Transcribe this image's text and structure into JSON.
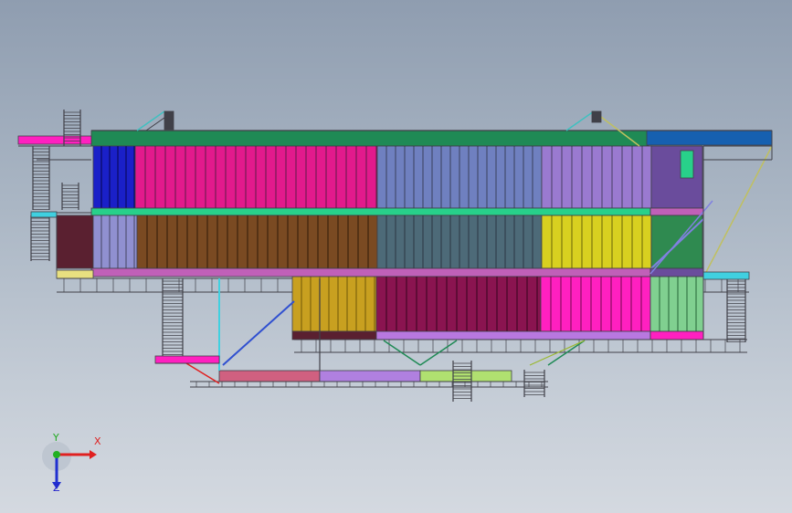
{
  "viewport": {
    "background_top": "#8f9db0",
    "background_bottom": "#d4d9e0",
    "model_name": ""
  },
  "triad": {
    "x_label": "X",
    "y_label": "Y",
    "z_label": "Z",
    "x_color": "#e02020",
    "y_color": "#22b022",
    "z_color": "#2030d0"
  },
  "colors": {
    "frame": "#404048",
    "top_green": "#1f8a55",
    "blue_cap": "#1660b0",
    "blue_dark": "#1a20c8",
    "magenta": "#e21a8c",
    "slate": "#6f80c0",
    "violet": "#9a7ad0",
    "purple": "#6a4c9c",
    "brown": "#7a4a22",
    "teal_gray": "#4d6a78",
    "yellow": "#d8d020",
    "lime": "#9ab830",
    "green_band": "#28d08a",
    "mauve_band": "#c060b8",
    "gold": "#c8a020",
    "plum": "#8a1450",
    "lavender": "#b878e0",
    "mint": "#80d090",
    "cyan": "#40d0e0",
    "pink_deck": "#d06080",
    "deck_violet": "#b080e0",
    "deck_lime": "#b0e070",
    "hot_pink": "#ff20c0",
    "maroon_dark": "#5a2030"
  }
}
